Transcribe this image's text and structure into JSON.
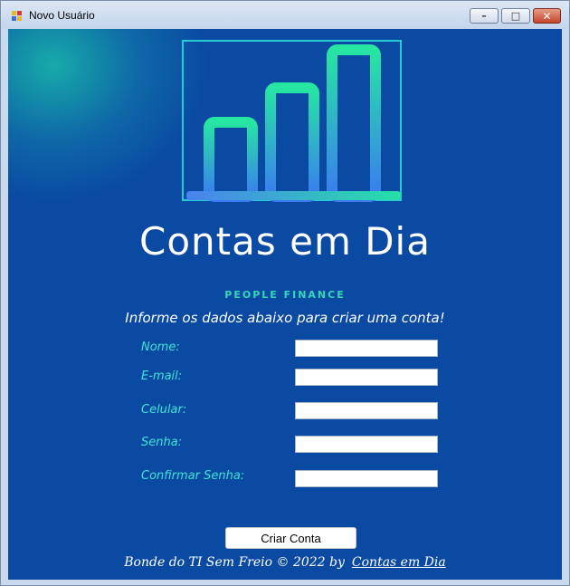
{
  "window": {
    "title": "Novo Usuário",
    "controls": {
      "minimize": "–",
      "maximize": "□",
      "close": "✕"
    }
  },
  "brand": {
    "name": "Contas em Dia",
    "tagline": "PEOPLE FINANCE",
    "logo_icon": "bar-chart-icon",
    "colors": {
      "bars_top": "#26e6a2",
      "bars_bottom": "#3a7cf0",
      "frame": "#28c9d6",
      "background": "#0a4aa3"
    }
  },
  "form": {
    "instruction": "Informe os dados abaixo para criar uma conta!",
    "fields": [
      {
        "label": "Nome:",
        "value": ""
      },
      {
        "label": "E-mail:",
        "value": ""
      },
      {
        "label": "Celular:",
        "value": ""
      },
      {
        "label": "Senha:",
        "value": ""
      },
      {
        "label": "Confirmar Senha:",
        "value": ""
      }
    ],
    "submit_label": "Criar Conta"
  },
  "footer": {
    "credit": "Bonde do TI Sem Freio © 2022  by",
    "link_text": "Contas em Dia"
  }
}
